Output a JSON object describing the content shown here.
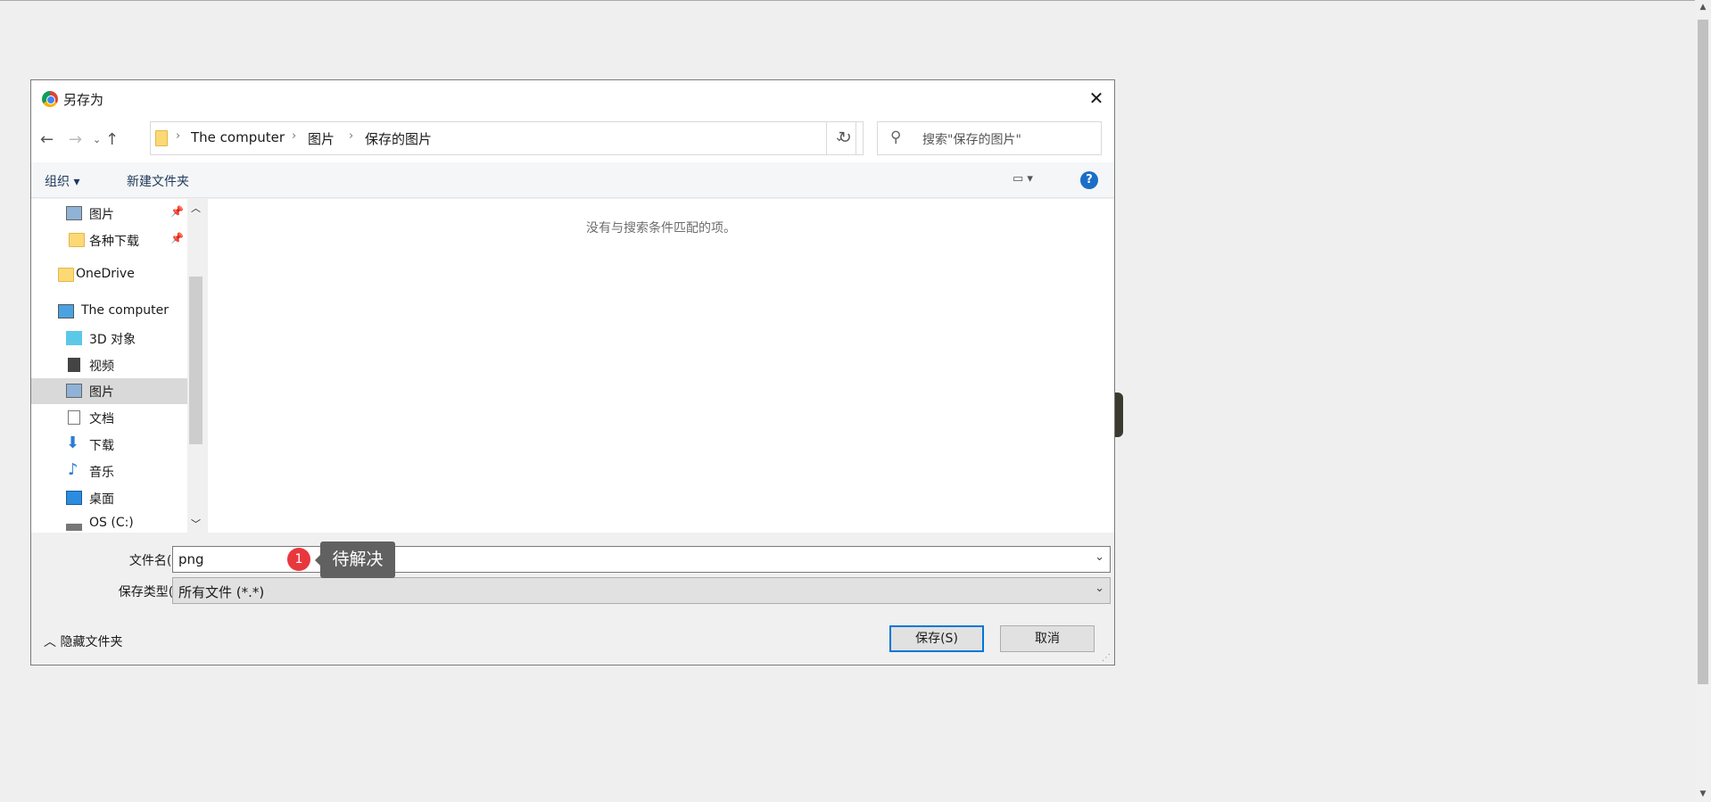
{
  "dialog": {
    "title": "另存为",
    "close_label": "✕"
  },
  "address": {
    "crumbs": [
      "The computer",
      "图片",
      "保存的图片"
    ],
    "search_placeholder": "搜索\"保存的图片\""
  },
  "toolbar": {
    "organize": "组织 ▾",
    "new_folder": "新建文件夹",
    "help": "?"
  },
  "nav": {
    "items": [
      {
        "label": "图片",
        "icon": "pictures-icon",
        "pinned": true
      },
      {
        "label": "各种下载",
        "icon": "folder-icon",
        "pinned": true
      },
      {
        "label": "OneDrive",
        "icon": "folder-icon"
      },
      {
        "label": "The computer",
        "icon": "computer-icon"
      },
      {
        "label": "3D 对象",
        "icon": "3d-objects-icon"
      },
      {
        "label": "视频",
        "icon": "video-icon"
      },
      {
        "label": "图片",
        "icon": "pictures-icon",
        "selected": true
      },
      {
        "label": "文档",
        "icon": "documents-icon"
      },
      {
        "label": "下载",
        "icon": "download-icon"
      },
      {
        "label": "音乐",
        "icon": "music-icon"
      },
      {
        "label": "桌面",
        "icon": "desktop-icon"
      },
      {
        "label": "OS (C:)",
        "icon": "drive-icon"
      }
    ]
  },
  "content": {
    "empty_message": "没有与搜索条件匹配的项。"
  },
  "form": {
    "filename_label": "文件名(N):",
    "filename_value": "png",
    "type_label": "保存类型(T):",
    "type_value": "所有文件 (*.*)"
  },
  "annotation": {
    "badge": "1",
    "tooltip": "待解决"
  },
  "footer": {
    "hide_folders": "隐藏文件夹",
    "save": "保存(S)",
    "cancel": "取消"
  },
  "colors": {
    "accent": "#0078d7",
    "badge": "#e8383d"
  }
}
